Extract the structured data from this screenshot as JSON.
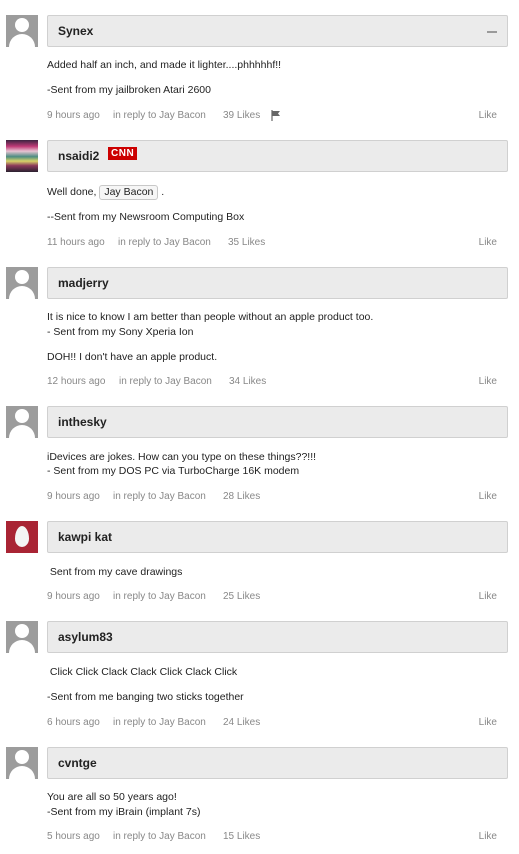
{
  "comments": [
    {
      "author": "Synex",
      "lines": [
        "Added half an inch, and made it lighter....phhhhhf!!",
        "-Sent from my jailbroken Atari 2600"
      ],
      "time": "9 hours ago",
      "reply": "in reply to Jay Bacon",
      "likes": "39 Likes",
      "like_label": "Like"
    },
    {
      "author": "nsaidi2",
      "badge": "CNN",
      "line1_prefix": "Well done,",
      "mention": "Jay Bacon",
      "line1_suffix": ".",
      "lines": [
        "--Sent from my Newsroom Computing Box"
      ],
      "time": "11 hours ago",
      "reply": "in reply to Jay Bacon",
      "likes": "35 Likes",
      "like_label": "Like"
    },
    {
      "author": "madjerry",
      "lines": [
        "It is nice to know I am better than people without an apple product too.",
        "- Sent from my Sony Xperia Ion",
        "DOH!!  I don't have an apple product."
      ],
      "time": "12 hours ago",
      "reply": "in reply to Jay Bacon",
      "likes": "34 Likes",
      "like_label": "Like"
    },
    {
      "author": "inthesky",
      "lines": [
        "iDevices are jokes. How can you type on these things??!!!",
        "- Sent from my DOS PC via TurboCharge 16K modem"
      ],
      "time": "9 hours ago",
      "reply": "in reply to Jay Bacon",
      "likes": "28 Likes",
      "like_label": "Like"
    },
    {
      "author": "kawpi kat",
      "lines": [
        " Sent from my cave drawings"
      ],
      "time": "9 hours ago",
      "reply": "in reply to Jay Bacon",
      "likes": "25 Likes",
      "like_label": "Like"
    },
    {
      "author": "asylum83",
      "lines": [
        " Click Click Clack Clack Click Clack Click",
        "-Sent from me banging two sticks together"
      ],
      "time": "6 hours ago",
      "reply": "in reply to Jay Bacon",
      "likes": "24 Likes",
      "like_label": "Like"
    },
    {
      "author": "cvntge",
      "lines": [
        "You are all so 50 years ago!",
        "-Sent from my iBrain (implant 7s)"
      ],
      "time": "5 hours ago",
      "reply": "in reply to Jay Bacon",
      "likes": "15 Likes",
      "like_label": "Like"
    }
  ],
  "icons": {
    "collapse": "minus-icon",
    "flag": "flag-icon",
    "avatar_default": "default-user-icon",
    "avatar_egg": "egg-icon"
  },
  "colors": {
    "badge": "#cc0000",
    "egg_avatar_bg": "#a92434",
    "name_bar_bg": "#ebebeb",
    "meta_text": "#888888"
  }
}
